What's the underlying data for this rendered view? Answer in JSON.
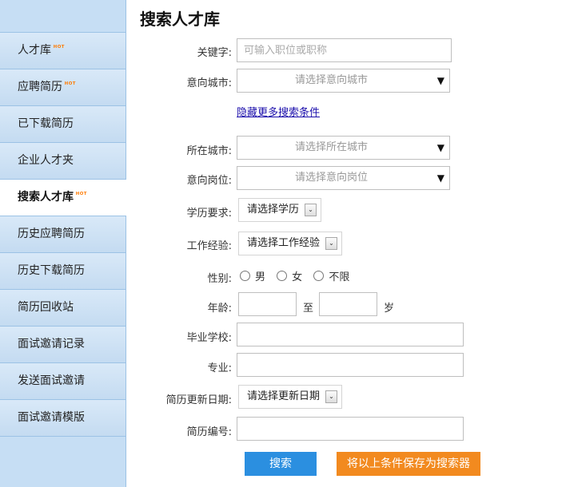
{
  "sidebar": {
    "items": [
      {
        "label": "人才库",
        "hot": true
      },
      {
        "label": "应聘简历",
        "hot": true
      },
      {
        "label": "已下载简历",
        "hot": false
      },
      {
        "label": "企业人才夹",
        "hot": false
      },
      {
        "label": "搜索人才库",
        "hot": true,
        "active": true
      },
      {
        "label": "历史应聘简历",
        "hot": false
      },
      {
        "label": "历史下载简历",
        "hot": false
      },
      {
        "label": "简历回收站",
        "hot": false
      },
      {
        "label": "面试邀请记录",
        "hot": false
      },
      {
        "label": "发送面试邀请",
        "hot": false
      },
      {
        "label": "面试邀请模版",
        "hot": false
      }
    ],
    "hot_badge": "HOT"
  },
  "page": {
    "title": "搜索人才库"
  },
  "form": {
    "keyword": {
      "label": "关键字:",
      "placeholder": "可输入职位或职称",
      "value": ""
    },
    "desired_city": {
      "label": "意向城市:",
      "placeholder": "请选择意向城市"
    },
    "toggle_link": "隐藏更多搜索条件",
    "current_city": {
      "label": "所在城市:",
      "placeholder": "请选择所在城市"
    },
    "desired_position": {
      "label": "意向岗位:",
      "placeholder": "请选择意向岗位"
    },
    "education": {
      "label": "学历要求:",
      "selected": "请选择学历"
    },
    "experience": {
      "label": "工作经验:",
      "selected": "请选择工作经验"
    },
    "gender": {
      "label": "性别:",
      "options": [
        "男",
        "女",
        "不限"
      ]
    },
    "age": {
      "label": "年龄:",
      "to": "至",
      "unit": "岁"
    },
    "school": {
      "label": "毕业学校:"
    },
    "major": {
      "label": "专业:"
    },
    "update_date": {
      "label": "简历更新日期:",
      "selected": "请选择更新日期"
    },
    "resume_no": {
      "label": "简历编号:"
    }
  },
  "buttons": {
    "search": "搜索",
    "save": "将以上条件保存为搜索器"
  },
  "icons": {
    "dropdown_arrow": "▼",
    "select_arrow": "⌄"
  },
  "colors": {
    "sidebar_bg": "#c6def4",
    "search_button": "#2b8fe0",
    "save_button": "#f28a1f"
  }
}
